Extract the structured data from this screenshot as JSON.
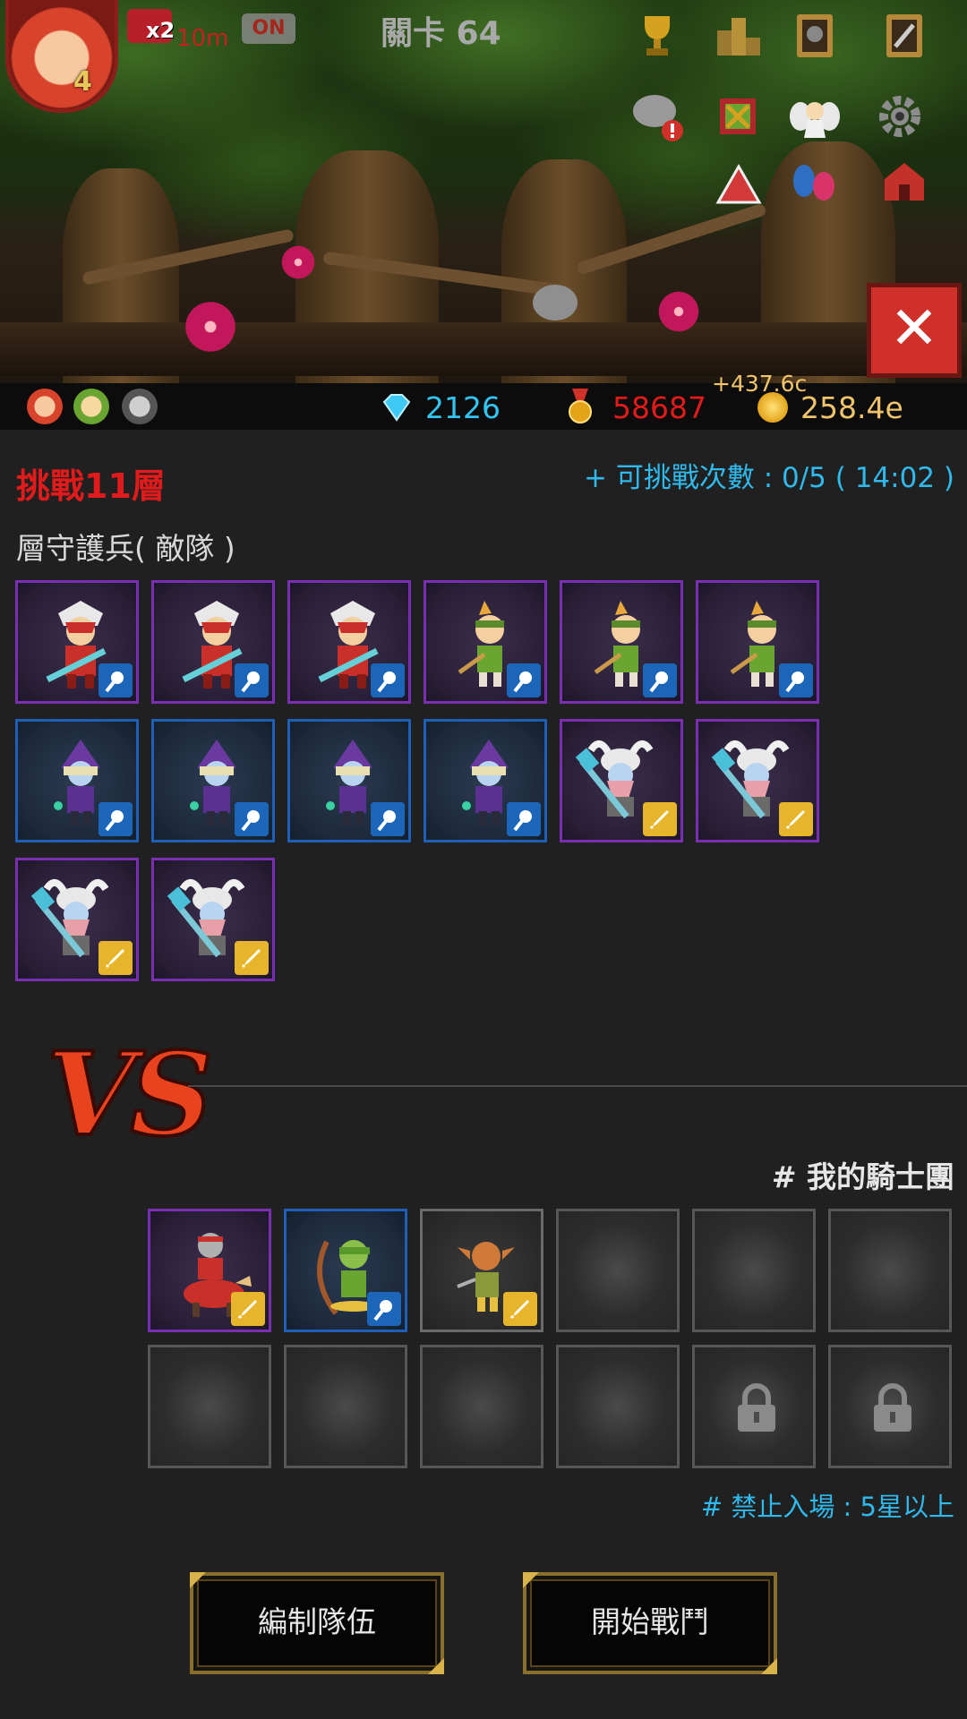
{
  "hud": {
    "avatar_level": "4",
    "speed_label": "x2",
    "speed_time": "10m",
    "auto_label": "ON",
    "stage_title": "關卡 64",
    "close_label": "✕"
  },
  "resources": {
    "gems": "2126",
    "medals": "58687",
    "gold": "258.4e",
    "gold_gain": "+437.6c"
  },
  "challenge": {
    "floor_title": "挑戰11層",
    "attempts": "+ 可挑戰次數 : 0/5 ( 14:02 )",
    "enemy_title": "層守護兵( 敵隊 )",
    "enemies": [
      {
        "unit": "red-knight",
        "rarity": "purple",
        "class": "mage"
      },
      {
        "unit": "red-knight",
        "rarity": "purple",
        "class": "mage"
      },
      {
        "unit": "red-knight",
        "rarity": "purple",
        "class": "mage"
      },
      {
        "unit": "elf-archer",
        "rarity": "purple",
        "class": "mage"
      },
      {
        "unit": "elf-archer",
        "rarity": "purple",
        "class": "mage"
      },
      {
        "unit": "elf-archer",
        "rarity": "purple",
        "class": "mage"
      },
      {
        "unit": "hooded-mage",
        "rarity": "blue",
        "class": "mage"
      },
      {
        "unit": "hooded-mage",
        "rarity": "blue",
        "class": "mage"
      },
      {
        "unit": "hooded-mage",
        "rarity": "blue",
        "class": "mage"
      },
      {
        "unit": "hooded-mage",
        "rarity": "blue",
        "class": "mage"
      },
      {
        "unit": "viking-warrior",
        "rarity": "purple",
        "class": "warrior"
      },
      {
        "unit": "viking-warrior",
        "rarity": "purple",
        "class": "warrior"
      },
      {
        "unit": "viking-warrior",
        "rarity": "purple",
        "class": "warrior"
      },
      {
        "unit": "viking-warrior",
        "rarity": "purple",
        "class": "warrior"
      }
    ]
  },
  "vs_label": "VS",
  "team": {
    "title": "# 我的騎士團",
    "slots": [
      {
        "unit": "mounted-knight",
        "rarity": "purple",
        "class": "warrior"
      },
      {
        "unit": "elf-ranger",
        "rarity": "blue",
        "class": "mage"
      },
      {
        "unit": "goblin-fighter",
        "rarity": "grey",
        "class": "warrior"
      },
      {
        "state": "empty"
      },
      {
        "state": "empty"
      },
      {
        "state": "empty"
      },
      {
        "state": "empty"
      },
      {
        "state": "empty"
      },
      {
        "state": "empty"
      },
      {
        "state": "empty"
      },
      {
        "state": "locked"
      },
      {
        "state": "locked"
      }
    ],
    "restriction": "# 禁止入場 : 5星以上"
  },
  "buttons": {
    "edit_team": "編制隊伍",
    "start_battle": "開始戰鬥"
  },
  "colors": {
    "purple_frame": "#7a2fb3",
    "blue_frame": "#1f5fb8",
    "mage_badge": "#1b66b8",
    "warrior_badge": "#e6b52c",
    "title_red": "#e11b1b",
    "info_blue": "#2fb9ec"
  }
}
